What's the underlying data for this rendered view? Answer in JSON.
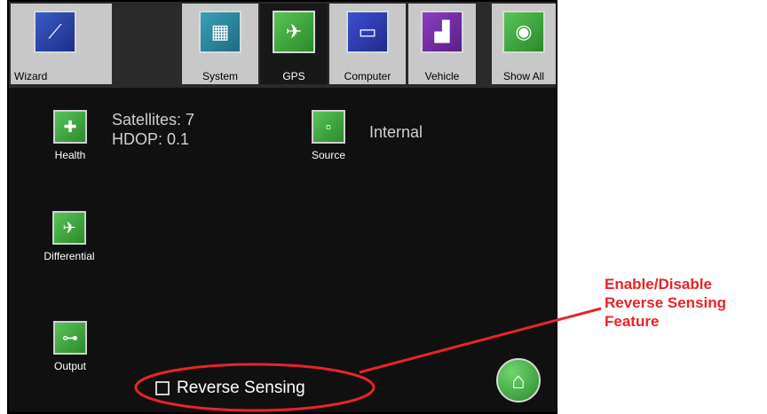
{
  "tabs": [
    {
      "label": "Wizard",
      "icon": "magic-wand-icon"
    },
    {
      "label": "System",
      "icon": "system-console-icon"
    },
    {
      "label": "GPS",
      "icon": "gps-satellite-icon",
      "selected": true
    },
    {
      "label": "Computer",
      "icon": "computer-wrench-icon"
    },
    {
      "label": "Vehicle",
      "icon": "vehicle-wrench-icon"
    },
    {
      "label": "Show All",
      "icon": "globe-icon"
    }
  ],
  "gps": {
    "health_label": "Health",
    "satellites": "Satellites: 7",
    "hdop": "HDOP: 0.1",
    "source_label": "Source",
    "source_value": "Internal",
    "differential_label": "Differential",
    "output_label": "Output",
    "reverse_sensing_label": "Reverse Sensing",
    "reverse_sensing_checked": false
  },
  "annotation": {
    "lines": [
      "Enable/Disable",
      "Reverse Sensing",
      "Feature"
    ],
    "color": "#e8232a"
  },
  "colors": {
    "accent_green": "#3aa83a",
    "screen_bg": "#101010",
    "tab_bg": "#c8c8c8"
  }
}
